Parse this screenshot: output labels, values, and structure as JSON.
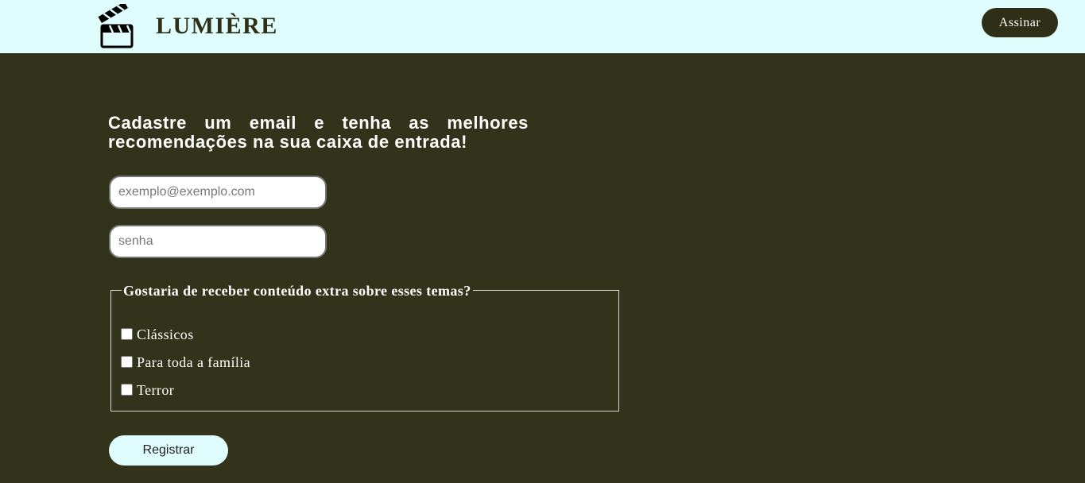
{
  "header": {
    "brand": "LUMIÈRE",
    "logo_icon": "clapperboard-icon",
    "subscribe_label": "Assinar"
  },
  "form": {
    "title": "Cadastre um email e tenha as melhores recomendações na sua caixa de entrada!",
    "email_placeholder": "exemplo@exemplo.com",
    "password_placeholder": "senha",
    "topics_legend": "Gostaria de receber conteúdo extra sobre esses temas?",
    "topics": [
      {
        "label": "Clássicos",
        "checked": false
      },
      {
        "label": "Para toda a família",
        "checked": false
      },
      {
        "label": "Terror",
        "checked": false
      }
    ],
    "submit_label": "Registrar"
  },
  "colors": {
    "background": "#33321a",
    "header_background": "#e0fdfd",
    "button_dark": "#2f2f17",
    "button_light": "#e0fdfd"
  }
}
